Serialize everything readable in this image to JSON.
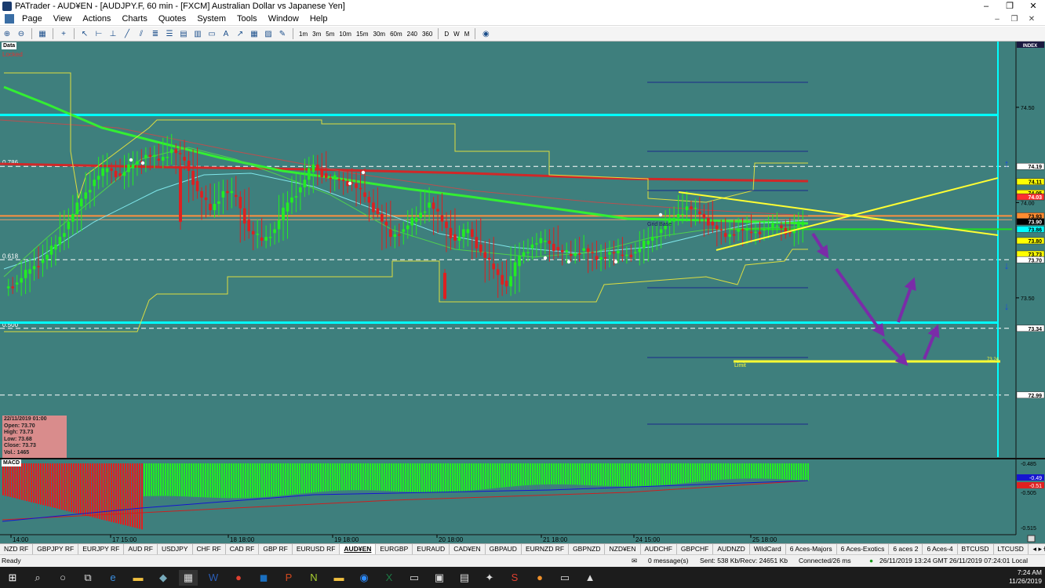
{
  "window": {
    "title": "PATrader - AUD¥EN - [AUDJPY.F, 60 min - [FXCM] Australian Dollar vs Japanese Yen]",
    "controls": [
      "–",
      "❐",
      "✕"
    ]
  },
  "menu": {
    "items": [
      "Page",
      "View",
      "Actions",
      "Charts",
      "Quotes",
      "System",
      "Tools",
      "Window",
      "Help"
    ],
    "right_controls": [
      "–",
      "❐",
      "✕"
    ]
  },
  "toolbar": {
    "timeframes": [
      "1m",
      "3m",
      "5m",
      "10m",
      "15m",
      "30m",
      "60m",
      "240",
      "360",
      "D",
      "W",
      "M"
    ]
  },
  "chart": {
    "data_label": "Data",
    "locked_label": "Locked",
    "index_label": "INDEX",
    "fib_labels": [
      {
        "text": "0.786",
        "price": 74.19
      },
      {
        "text": "0.618",
        "price": 73.7
      },
      {
        "text": "0.500",
        "price": 73.34
      }
    ],
    "grid_base_label": "Grid Base",
    "limit_label": "Limit",
    "limit_value": "73.24",
    "price_axis": {
      "min": 72.87,
      "max": 74.66,
      "ticks": [
        "74.50",
        "74.00",
        "73.50"
      ],
      "markers": [
        {
          "text": "74.19",
          "price": 74.19,
          "bg": "#ffffff",
          "fg": "#000000"
        },
        {
          "text": "74.11",
          "price": 74.11,
          "bg": "#ffff00",
          "fg": "#000000"
        },
        {
          "text": "74.05",
          "price": 74.05,
          "bg": "#ffff00",
          "fg": "#000000"
        },
        {
          "text": "74.03",
          "price": 74.03,
          "bg": "#ff3030",
          "fg": "#ffffff"
        },
        {
          "text": "73.93",
          "price": 73.93,
          "bg": "#ff8c30",
          "fg": "#000000"
        },
        {
          "text": "73.90",
          "price": 73.9,
          "bg": "#000000",
          "fg": "#ffffff"
        },
        {
          "text": "73.86",
          "price": 73.86,
          "bg": "#00ffff",
          "fg": "#000000"
        },
        {
          "text": "73.80",
          "price": 73.8,
          "bg": "#ffff00",
          "fg": "#000000"
        },
        {
          "text": "73.73",
          "price": 73.73,
          "bg": "#ffff00",
          "fg": "#000000"
        },
        {
          "text": "73.70",
          "price": 73.7,
          "bg": "#ffffff",
          "fg": "#000000"
        },
        {
          "text": "73.34",
          "price": 73.34,
          "bg": "#ffffff",
          "fg": "#000000"
        },
        {
          "text": "72.99",
          "price": 72.99,
          "bg": "#ffffff",
          "fg": "#000000"
        }
      ]
    },
    "time_labels": [
      "14:00",
      "17 15:00",
      "18 18:00",
      "19 18:00",
      "20 18:00",
      "21 18:00",
      "24 15:00",
      "25 18:00"
    ],
    "info_box": {
      "date": "22/11/2019 01:00",
      "open": "Open: 73.70",
      "high": "High: 73.73",
      "low": "Low: 73.68",
      "close": "Close: 73.73",
      "volume": "Vol.: 1465"
    },
    "macd": {
      "label": "MACD",
      "axis": [
        "-0.485",
        "-0.505",
        "-0.515"
      ],
      "markers": [
        {
          "text": "-0.49",
          "bg": "#1515d0",
          "fg": "#ffffff"
        },
        {
          "text": "-0.51",
          "bg": "#e02020",
          "fg": "#ffffff"
        }
      ]
    }
  },
  "tabs": {
    "items": [
      "NZD RF",
      "GBPJPY RF",
      "EURJPY RF",
      "AUD RF",
      "USDJPY",
      "CHF RF",
      "CAD RF",
      "GBP RF",
      "EURUSD RF",
      "AUD¥EN",
      "EURGBP",
      "EURAUD",
      "CAD¥EN",
      "GBPAUD",
      "EURNZD RF",
      "GBPNZD",
      "NZD¥EN",
      "AUDCHF",
      "GBPCHF",
      "AUDNZD",
      "WildCard",
      "6 Aces-Majors",
      "6 Aces-Exotics",
      "6 aces 2",
      "6 Aces-4",
      "BTCUSD",
      "LTCUSD",
      "ETHUSD",
      "Apple"
    ],
    "active": "AUD¥EN"
  },
  "status": {
    "ready": "Ready",
    "messages": "0 message(s)",
    "traffic": "Sent: 538 Kb/Recv: 24651 Kb",
    "connection": "Connected/26 ms",
    "times": "26/11/2019 13:24 GMT  26/11/2019 07:24:01 Local"
  },
  "taskbar": {
    "time": "7:24 AM",
    "date": "11/26/2019"
  },
  "colors": {
    "chart_bg": "#3e7f7d",
    "bull": "#22ee22",
    "bear": "#dd2020",
    "ma_red": "#d02828",
    "ma_green": "#33ee33",
    "cyan_level": "#00ffff",
    "yellow": "#ffff33",
    "orange_level": "#ff9040",
    "arrows": "#7a2ca8"
  }
}
